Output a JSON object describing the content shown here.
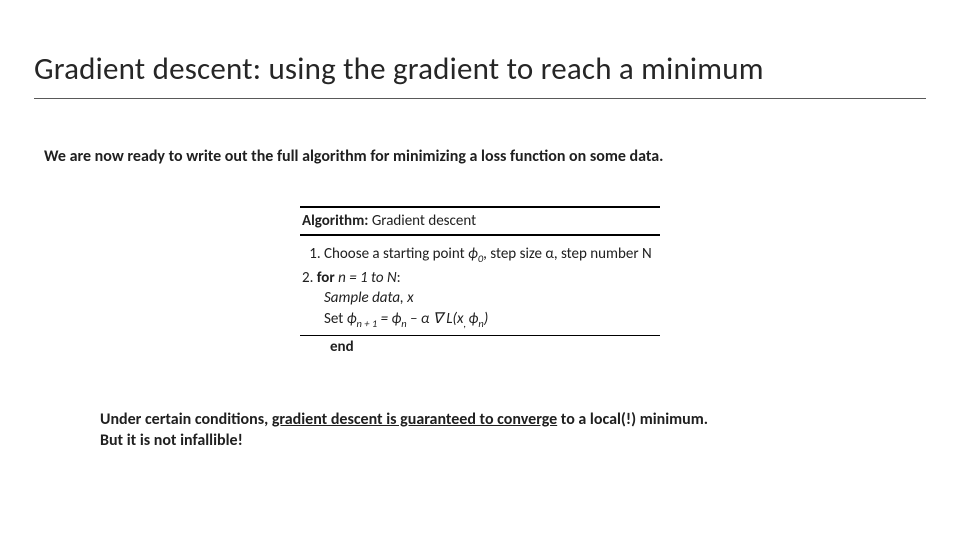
{
  "title": "Gradient descent: using the gradient to reach a minimum",
  "intro": "We are now ready to write out the full algorithm for minimizing a loss function on some data.",
  "algorithm": {
    "heading_bold": "Algorithm:",
    "heading_rest": " Gradient descent",
    "step1_a": "Choose a starting point ",
    "step1_phi0": "ϕ",
    "step1_sub0": "0",
    "step1_b": ", step size α, step number N",
    "step2_prefix": "2. ",
    "step2_for": "for",
    "step2_cond": " n = 1 to N",
    "step2_colon": ":",
    "sample_line": "Sample data, x",
    "set_a": "Set ",
    "set_phi": "ϕ",
    "set_sub_np1": "n + 1",
    "set_eq": " = ",
    "set_phi2": "ϕ",
    "set_sub_n": "n",
    "set_minus_alpha": " – α ",
    "set_nabla": "∇ L(x",
    "set_comma": ", ",
    "set_phi3": "ϕ",
    "set_sub_n2": "n",
    "set_close": ")",
    "end": "end"
  },
  "notes": {
    "line1_a": "Under certain conditions, ",
    "line1_u": "gradient descent is guaranteed to converge",
    "line1_b": " to a local(!) minimum.",
    "line2": "But it is not infallible!"
  }
}
